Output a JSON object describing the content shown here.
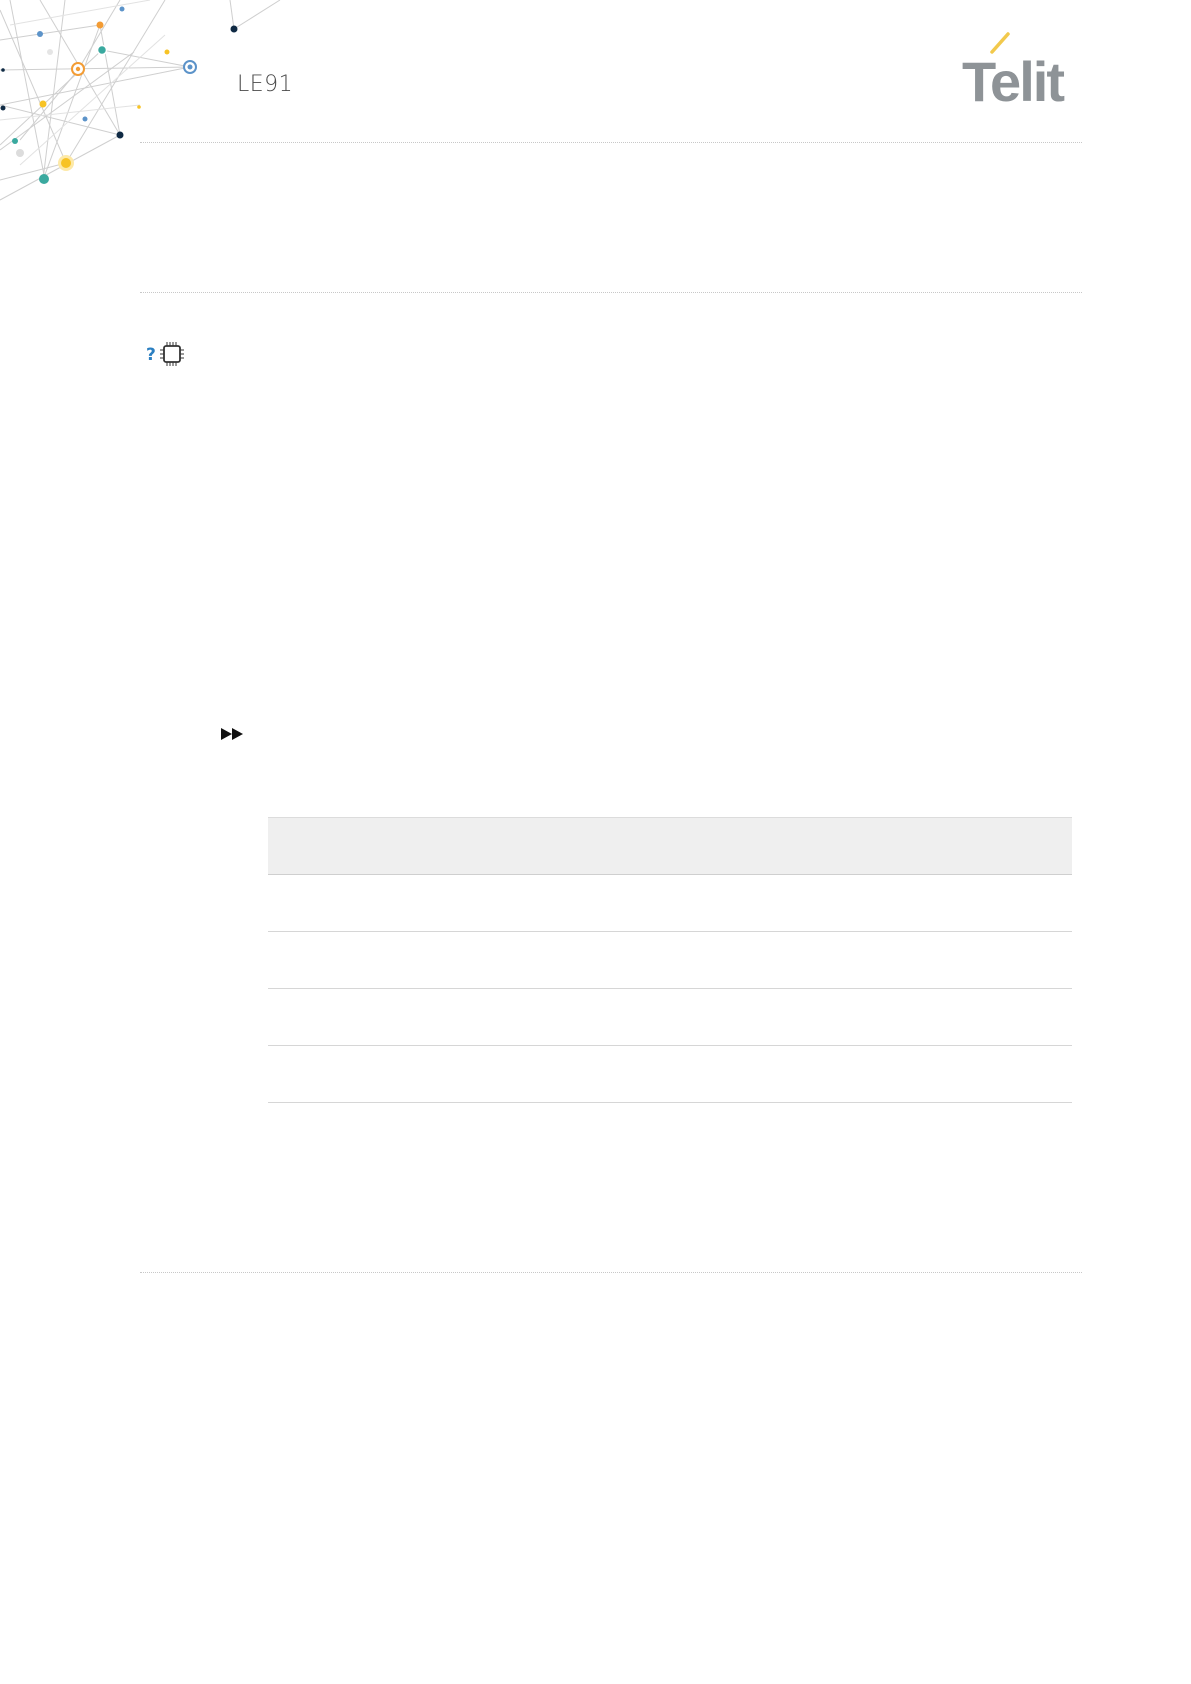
{
  "header": {
    "doc_title": "LE91",
    "brand": "Telit",
    "brand_accent_color": "#f2c94c",
    "brand_text_color": "#8e9397"
  },
  "icons": {
    "help": "question-chip-icon",
    "next": "fast-forward-icon"
  },
  "table": {
    "columns": [
      ""
    ],
    "rows": [
      [
        ""
      ],
      [
        ""
      ],
      [
        ""
      ],
      [
        ""
      ]
    ]
  },
  "decor_colors": {
    "teal": "#3aa99f",
    "orange": "#f39c34",
    "yellow": "#f7c325",
    "navy": "#0f2a44",
    "blue": "#5c93c9",
    "lines": "#c9c9c9"
  }
}
